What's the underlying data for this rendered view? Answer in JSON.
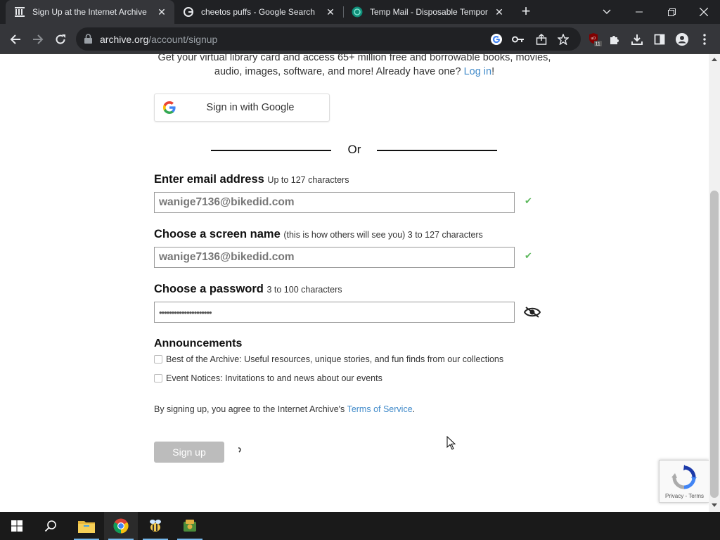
{
  "browser": {
    "tabs": [
      {
        "title": "Sign Up at the Internet Archive",
        "active": true,
        "favicon": "archive-icon"
      },
      {
        "title": "cheetos puffs - Google Search",
        "active": false,
        "favicon": "google-icon"
      },
      {
        "title": "Temp Mail - Disposable Tempor",
        "active": false,
        "favicon": "tempmail-icon"
      }
    ],
    "url_domain": "archive.org",
    "url_path": "/account/signup",
    "extension_badge": "11"
  },
  "page": {
    "intro_text": "Get your virtual library card and access 65+ million free and borrowable books, movies, audio, images, software, and more! Already have one?",
    "login_link": "Log in",
    "login_suffix": "!",
    "google_button": "Sign in with Google",
    "or_text": "Or",
    "email": {
      "label": "Enter email address",
      "hint": "Up to 127 characters",
      "value": "wanige7136@bikedid.com"
    },
    "screenname": {
      "label": "Choose a screen name",
      "hint": "(this is how others will see you) 3 to 127 characters",
      "value": "wanige7136@bikedid.com"
    },
    "password": {
      "label": "Choose a password",
      "hint": "3 to 100 characters",
      "value": "•••••••••••••••••••••"
    },
    "valid_mark": "✔",
    "announcements": {
      "title": "Announcements",
      "items": [
        "Best of the Archive: Useful resources, unique stories, and fun finds from our collections",
        "Event Notices: Invitations to and news about our events"
      ]
    },
    "terms_prefix": "By signing up, you agree to the Internet Archive's",
    "terms_link": "Terms of Service",
    "terms_suffix": ".",
    "signup_button": "Sign up",
    "recaptcha_links": "Privacy - Terms"
  },
  "colors": {
    "link": "#428bca",
    "valid": "#5cb85c",
    "signup_disabled": "#bcbcbc"
  }
}
